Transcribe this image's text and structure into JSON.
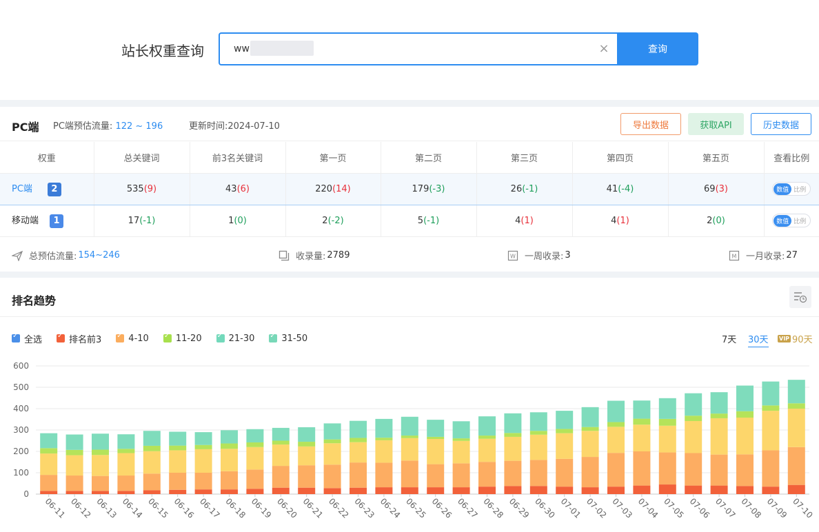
{
  "search": {
    "title": "站长权重查询",
    "input_value": "ww",
    "button_label": "查询"
  },
  "pc_header": {
    "title": "PC端",
    "traffic_label": "PC端预估流量:",
    "traffic_value": "122 ~ 196",
    "update_label": "更新时间:",
    "update_value": "2024-07-10",
    "export_label": "导出数据",
    "api_label": "获取API",
    "history_label": "历史数据"
  },
  "table": {
    "columns": [
      "权重",
      "总关键词",
      "前3名关键词",
      "第一页",
      "第二页",
      "第三页",
      "第四页",
      "第五页",
      "查看比例"
    ],
    "rows": [
      {
        "label": "PC端",
        "weight": "2",
        "cells": [
          {
            "v": "535",
            "d": "(9)",
            "c": "red"
          },
          {
            "v": "43",
            "d": "(6)",
            "c": "red"
          },
          {
            "v": "220",
            "d": "(14)",
            "c": "red"
          },
          {
            "v": "179",
            "d": "(-3)",
            "c": "green"
          },
          {
            "v": "26",
            "d": "(-1)",
            "c": "green"
          },
          {
            "v": "41",
            "d": "(-4)",
            "c": "green"
          },
          {
            "v": "69",
            "d": "(3)",
            "c": "red"
          }
        ]
      },
      {
        "label": "移动端",
        "weight": "1",
        "cells": [
          {
            "v": "17",
            "d": "(-1)",
            "c": "green"
          },
          {
            "v": "1",
            "d": "(0)",
            "c": "green"
          },
          {
            "v": "2",
            "d": "(-2)",
            "c": "green"
          },
          {
            "v": "5",
            "d": "(-1)",
            "c": "green"
          },
          {
            "v": "4",
            "d": "(1)",
            "c": "red"
          },
          {
            "v": "4",
            "d": "(1)",
            "c": "red"
          },
          {
            "v": "2",
            "d": "(0)",
            "c": "green"
          }
        ]
      }
    ],
    "toggle_on": "数值",
    "toggle_off": "比例"
  },
  "stats": {
    "total_traffic_label": "总预估流量:",
    "total_traffic_value": "154~246",
    "indexed_label": "收录量:",
    "indexed_value": "2789",
    "week_label": "一周收录:",
    "week_value": "3",
    "month_label": "一月收录:",
    "month_value": "27"
  },
  "trend": {
    "title": "排名趋势",
    "legend": [
      {
        "label": "全选",
        "color": "#4a8fe8"
      },
      {
        "label": "排名前3",
        "color": "#f2613a"
      },
      {
        "label": "4-10",
        "color": "#fbad5e"
      },
      {
        "label": "11-20",
        "color": "#a8e04d"
      },
      {
        "label": "21-30",
        "color": "#73d9bb"
      },
      {
        "label": "31-50",
        "color": "#78d8b8"
      }
    ],
    "ranges": {
      "r7": "7天",
      "r30": "30天",
      "r90": "90天",
      "vip": "VIP"
    }
  },
  "colors": {
    "top3": "#f2613a",
    "r4_10": "#fdad62",
    "r11_20_a": "#fdd66b",
    "r11_20_b": "#b5e35a",
    "r31_50": "#7fdcbc",
    "accent": "#2d8cf0"
  },
  "chart_data": {
    "type": "bar",
    "stacked": true,
    "categories": [
      "06-11",
      "06-12",
      "06-13",
      "06-14",
      "06-15",
      "06-16",
      "06-17",
      "06-18",
      "06-19",
      "06-20",
      "06-21",
      "06-22",
      "06-23",
      "06-24",
      "06-25",
      "06-26",
      "06-27",
      "06-28",
      "06-29",
      "06-30",
      "07-01",
      "07-02",
      "07-03",
      "07-04",
      "07-05",
      "07-06",
      "07-07",
      "07-08",
      "07-09",
      "07-10"
    ],
    "ylim": [
      0,
      600
    ],
    "yticks": [
      0,
      100,
      200,
      300,
      400,
      500,
      600
    ],
    "series": [
      {
        "name": "排名前3",
        "color": "#f2613a",
        "values": [
          15,
          15,
          15,
          15,
          18,
          20,
          22,
          22,
          25,
          30,
          30,
          28,
          30,
          32,
          32,
          32,
          32,
          35,
          38,
          38,
          35,
          32,
          35,
          40,
          45,
          40,
          40,
          38,
          35,
          43
        ]
      },
      {
        "name": "4-10",
        "color": "#fdad62",
        "values": [
          75,
          72,
          70,
          72,
          78,
          80,
          78,
          85,
          90,
          102,
          105,
          110,
          118,
          115,
          125,
          108,
          112,
          116,
          118,
          122,
          130,
          142,
          158,
          160,
          150,
          152,
          145,
          148,
          170,
          177
        ]
      },
      {
        "name": "",
        "color": "#fdd66b",
        "values": [
          100,
          95,
          98,
          105,
          105,
          105,
          110,
          105,
          105,
          100,
          88,
          100,
          95,
          105,
          105,
          118,
          105,
          108,
          112,
          118,
          120,
          122,
          122,
          125,
          125,
          150,
          170,
          172,
          185,
          180
        ]
      },
      {
        "name": "11-20",
        "color": "#b5e35a",
        "values": [
          25,
          25,
          25,
          20,
          25,
          22,
          20,
          25,
          22,
          18,
          22,
          18,
          20,
          12,
          12,
          10,
          12,
          15,
          18,
          18,
          20,
          18,
          22,
          28,
          32,
          25,
          22,
          30,
          25,
          25
        ]
      },
      {
        "name": "31-50",
        "color": "#7fdcbc",
        "values": [
          70,
          72,
          75,
          68,
          70,
          65,
          60,
          62,
          62,
          60,
          68,
          75,
          80,
          88,
          88,
          80,
          80,
          90,
          92,
          87,
          85,
          93,
          100,
          85,
          97,
          105,
          100,
          120,
          112,
          110
        ]
      }
    ]
  }
}
